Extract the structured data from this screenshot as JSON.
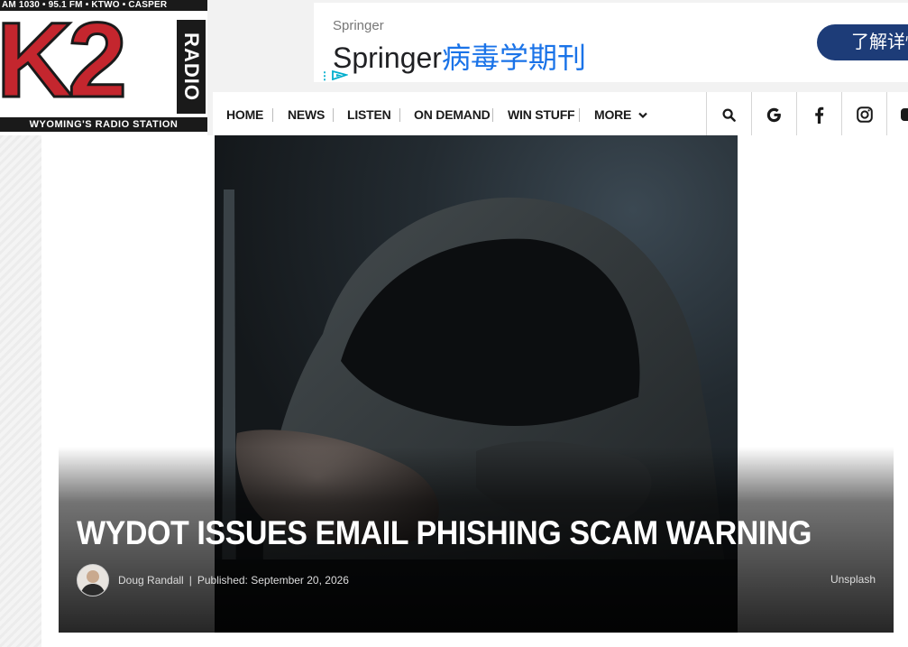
{
  "logo": {
    "top_text": "AM 1030 • 95.1 FM • KTWO • CASPER",
    "main_text": "K2",
    "side_text": "RADIO",
    "bottom_text": "WYOMING'S RADIO STATION"
  },
  "ad": {
    "advertiser": "Springer",
    "title_brand": "Springer",
    "title_cn": "病毒学期刊",
    "cta": "了解详情",
    "colors": {
      "cta_bg": "#1d3c78",
      "cn_text": "#1a73e8"
    }
  },
  "nav": {
    "items": [
      "HOME",
      "NEWS",
      "LISTEN",
      "ON DEMAND",
      "WIN STUFF",
      "MORE"
    ],
    "icons": [
      "search-icon",
      "google-icon",
      "facebook-icon",
      "instagram-icon",
      "youtube-icon"
    ]
  },
  "article": {
    "headline": "WYDOT ISSUES EMAIL PHISHING SCAM WARNING",
    "author": "Doug Randall",
    "separator": "|",
    "published": "Published: September 20, 2026",
    "photo_credit": "Unsplash"
  },
  "colors": {
    "brand_red": "#c4262e",
    "dark": "#1a1a1a"
  }
}
